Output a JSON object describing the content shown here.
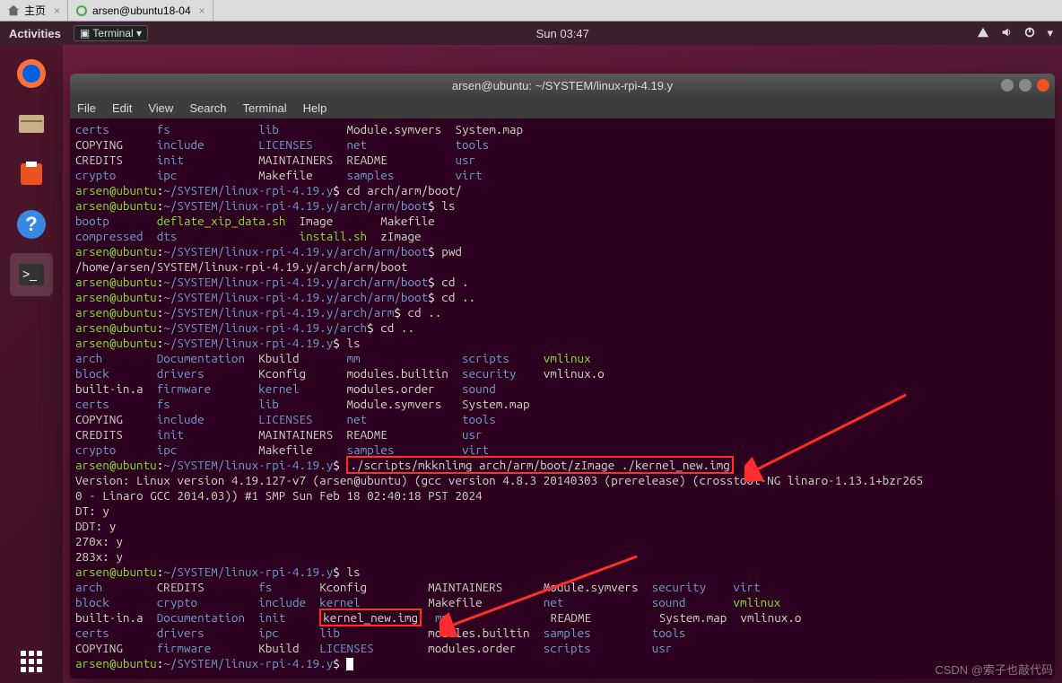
{
  "browser_tabs": {
    "home": "主页",
    "tab2": "arsen@ubuntu18-04"
  },
  "topbar": {
    "activities": "Activities",
    "terminal": "Terminal",
    "time": "Sun 03:47"
  },
  "term": {
    "title": "arsen@ubuntu: ~/SYSTEM/linux-rpi-4.19.y",
    "menu": {
      "file": "File",
      "edit": "Edit",
      "view": "View",
      "search": "Search",
      "terminal": "Terminal",
      "help": "Help"
    }
  },
  "listing1": {
    "r1": [
      "certs",
      "fs",
      "lib",
      "Module.symvers",
      "System.map"
    ],
    "r2": [
      "COPYING",
      "include",
      "LICENSES",
      "net",
      "tools"
    ],
    "r3": [
      "CREDITS",
      "init",
      "MAINTAINERS",
      "README",
      "usr"
    ],
    "r4": [
      "crypto",
      "ipc",
      "Makefile",
      "samples",
      "virt"
    ]
  },
  "cmd1": {
    "user": "arsen@ubuntu",
    "path": "~/SYSTEM/linux-rpi-4.19.y",
    "dollar": "$",
    "cmd": "cd arch/arm/boot/"
  },
  "cmd2": {
    "user": "arsen@ubuntu",
    "path": "~/SYSTEM/linux-rpi-4.19.y/arch/arm/boot",
    "dollar": "$",
    "cmd": "ls"
  },
  "listing2": {
    "r1": [
      "bootp",
      "deflate_xip_data.sh",
      "Image",
      "Makefile"
    ],
    "r2": [
      "compressed",
      "dts",
      "",
      "install.sh",
      "zImage"
    ]
  },
  "cmd3": {
    "user": "arsen@ubuntu",
    "path": "~/SYSTEM/linux-rpi-4.19.y/arch/arm/boot",
    "dollar": "$",
    "cmd": "pwd"
  },
  "pwd_out": "/home/arsen/SYSTEM/linux-rpi-4.19.y/arch/arm/boot",
  "cmd4": {
    "user": "arsen@ubuntu",
    "path": "~/SYSTEM/linux-rpi-4.19.y/arch/arm/boot",
    "dollar": "$",
    "cmd": "cd ."
  },
  "cmd5": {
    "user": "arsen@ubuntu",
    "path": "~/SYSTEM/linux-rpi-4.19.y/arch/arm/boot",
    "dollar": "$",
    "cmd": "cd .."
  },
  "cmd6": {
    "user": "arsen@ubuntu",
    "path": "~/SYSTEM/linux-rpi-4.19.y/arch/arm",
    "dollar": "$",
    "cmd": "cd .."
  },
  "cmd7": {
    "user": "arsen@ubuntu",
    "path": "~/SYSTEM/linux-rpi-4.19.y/arch",
    "dollar": "$",
    "cmd": "cd .."
  },
  "cmd8": {
    "user": "arsen@ubuntu",
    "path": "~/SYSTEM/linux-rpi-4.19.y",
    "dollar": "$",
    "cmd": "ls"
  },
  "listing3": {
    "r1": [
      "arch",
      "Documentation",
      "Kbuild",
      "mm",
      "scripts",
      "vmlinux"
    ],
    "r2": [
      "block",
      "drivers",
      "Kconfig",
      "modules.builtin",
      "security",
      "vmlinux.o"
    ],
    "r3": [
      "built-in.a",
      "firmware",
      "kernel",
      "modules.order",
      "sound"
    ],
    "r4": [
      "certs",
      "fs",
      "lib",
      "Module.symvers",
      "System.map"
    ],
    "r5": [
      "COPYING",
      "include",
      "LICENSES",
      "net",
      "tools"
    ],
    "r6": [
      "CREDITS",
      "init",
      "MAINTAINERS",
      "README",
      "usr"
    ],
    "r7": [
      "crypto",
      "ipc",
      "Makefile",
      "samples",
      "virt"
    ]
  },
  "cmd9": {
    "user": "arsen@ubuntu",
    "path": "~/SYSTEM/linux-rpi-4.19.y",
    "dollar": "$",
    "cmd": "./scripts/mkknlimg arch/arm/boot/zImage ./kernel_new.img"
  },
  "kernel_out": {
    "l1": "Version: Linux version 4.19.127-v7 (arsen@ubuntu) (gcc version 4.8.3 20140303 (prerelease) (crosstool-NG linaro-1.13.1+bzr265",
    "l2": "0 - Linaro GCC 2014.03)) #1 SMP Sun Feb 18 02:40:18 PST 2024",
    "l3": "DT: y",
    "l4": "DDT: y",
    "l5": "270x: y",
    "l6": "283x: y"
  },
  "cmd10": {
    "user": "arsen@ubuntu",
    "path": "~/SYSTEM/linux-rpi-4.19.y",
    "dollar": "$",
    "cmd": "ls"
  },
  "listing4": {
    "r1": [
      "arch",
      "CREDITS",
      "fs",
      "Kconfig",
      "MAINTAINERS",
      "Module.symvers",
      "security",
      "virt"
    ],
    "r2": [
      "block",
      "crypto",
      "include",
      "kernel",
      "Makefile",
      "net",
      "sound",
      "vmlinux"
    ],
    "r3": [
      "built-in.a",
      "Documentation",
      "init",
      "kernel_new.img",
      "mm",
      "README",
      "System.map",
      "vmlinux.o"
    ],
    "r4": [
      "certs",
      "drivers",
      "ipc",
      "lib",
      "modules.builtin",
      "samples",
      "tools"
    ],
    "r5": [
      "COPYING",
      "firmware",
      "Kbuild",
      "LICENSES",
      "modules.order",
      "scripts",
      "usr"
    ]
  },
  "cmd11": {
    "user": "arsen@ubuntu",
    "path": "~/SYSTEM/linux-rpi-4.19.y",
    "dollar": "$"
  },
  "watermark": "CSDN @索子也敲代码"
}
